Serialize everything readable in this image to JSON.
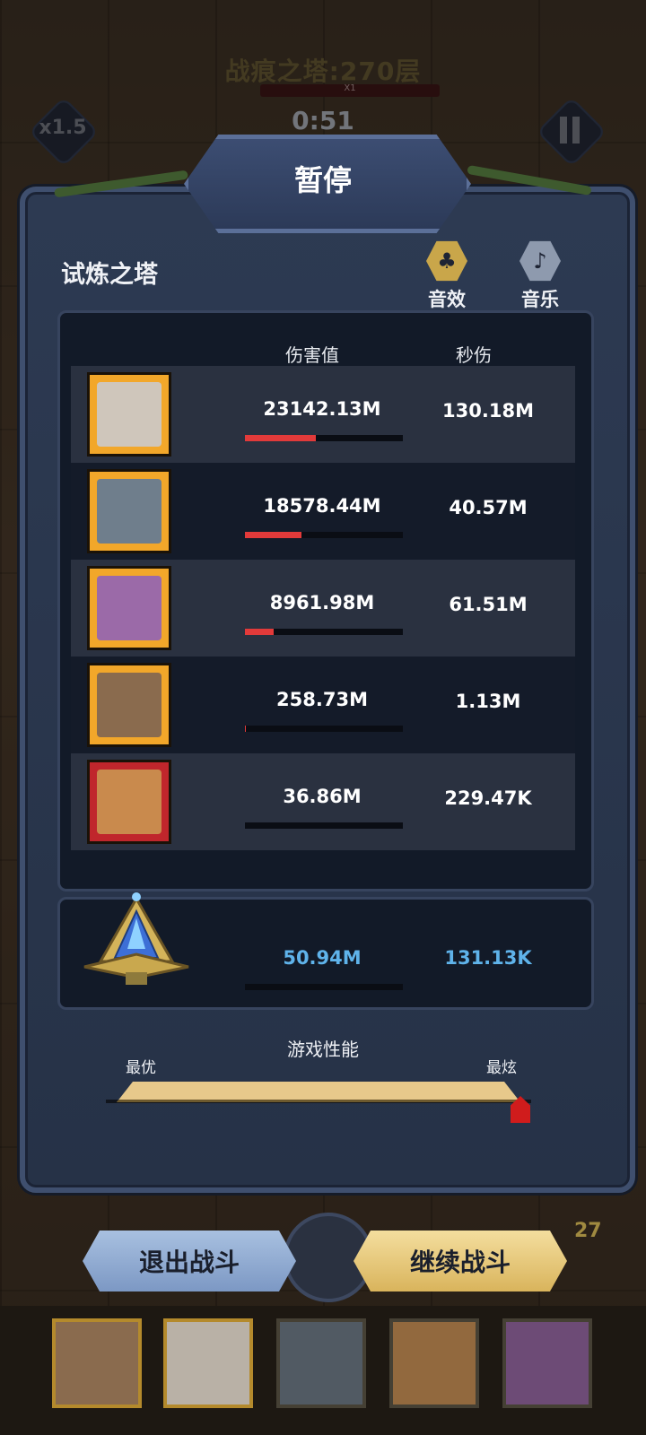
{
  "hud": {
    "tower_title": "战痕之塔:270层",
    "boss_multiplier": "X1",
    "speed": "x1.5",
    "timer": "0:51",
    "coins": "27"
  },
  "dialog": {
    "title": "暂停",
    "section_title": "试炼之塔",
    "sfx_label": "音效",
    "bgm_label": "音乐"
  },
  "stats": {
    "col_damage": "伤害值",
    "col_dps": "秒伤",
    "rows": [
      {
        "damage": "23142.13M",
        "dps": "130.18M",
        "bar": 0.45,
        "frame": "gold",
        "face": "#cfc6bb"
      },
      {
        "damage": "18578.44M",
        "dps": "40.57M",
        "bar": 0.36,
        "frame": "gold",
        "face": "#6f7e8c"
      },
      {
        "damage": "8961.98M",
        "dps": "61.51M",
        "bar": 0.18,
        "frame": "gold",
        "face": "#9b6aa8"
      },
      {
        "damage": "258.73M",
        "dps": "1.13M",
        "bar": 0.005,
        "frame": "gold",
        "face": "#8a6b4e"
      },
      {
        "damage": "36.86M",
        "dps": "229.47K",
        "bar": 0.0,
        "frame": "red",
        "face": "#c98a4d"
      }
    ]
  },
  "artifact": {
    "damage": "50.94M",
    "dps": "131.13K",
    "bar": 0.0
  },
  "performance": {
    "title": "游戏性能",
    "left_label": "最优",
    "right_label": "最炫",
    "level": 1.0
  },
  "buttons": {
    "exit": "退出战斗",
    "continue": "继续战斗"
  },
  "colors": {
    "accent_gold": "#d9b45c",
    "damage_bar": "#e23a3a",
    "artifact_text": "#5fb3ea"
  }
}
